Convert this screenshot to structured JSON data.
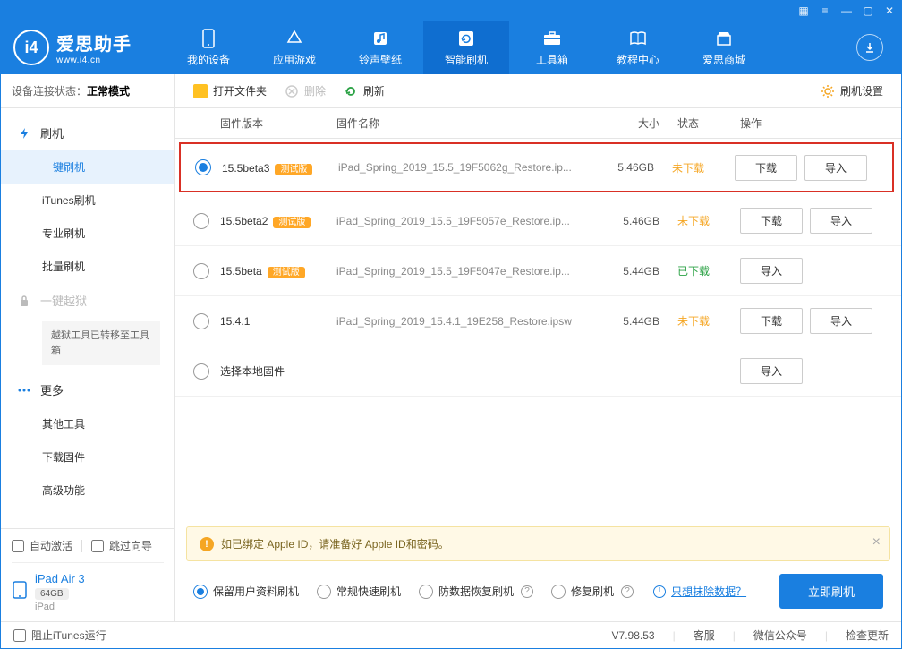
{
  "app": {
    "name": "爱思助手",
    "url": "www.i4.cn"
  },
  "nav": {
    "items": [
      {
        "label": "我的设备"
      },
      {
        "label": "应用游戏"
      },
      {
        "label": "铃声壁纸"
      },
      {
        "label": "智能刷机"
      },
      {
        "label": "工具箱"
      },
      {
        "label": "教程中心"
      },
      {
        "label": "爱思商城"
      }
    ]
  },
  "sidebar": {
    "status_label": "设备连接状态：",
    "status_value": "正常模式",
    "flash_root": "刷机",
    "items": [
      {
        "label": "一键刷机"
      },
      {
        "label": "iTunes刷机"
      },
      {
        "label": "专业刷机"
      },
      {
        "label": "批量刷机"
      }
    ],
    "jailbreak": "一键越狱",
    "jailbreak_msg": "越狱工具已转移至工具箱",
    "more": "更多",
    "more_items": [
      {
        "label": "其他工具"
      },
      {
        "label": "下载固件"
      },
      {
        "label": "高级功能"
      }
    ],
    "auto_activate": "自动激活",
    "skip_guide": "跳过向导",
    "device_name": "iPad Air 3",
    "device_storage": "64GB",
    "device_type": "iPad"
  },
  "toolbar": {
    "open": "打开文件夹",
    "delete": "删除",
    "refresh": "刷新",
    "settings": "刷机设置"
  },
  "table": {
    "headers": {
      "version": "固件版本",
      "name": "固件名称",
      "size": "大小",
      "status": "状态",
      "ops": "操作"
    },
    "beta_badge": "测试版",
    "btn_download": "下载",
    "btn_import": "导入",
    "rows": [
      {
        "version": "15.5beta3",
        "beta": true,
        "name": "iPad_Spring_2019_15.5_19F5062g_Restore.ip...",
        "size": "5.46GB",
        "status": "未下载",
        "status_cls": "orange",
        "show_dl": true,
        "selected": true
      },
      {
        "version": "15.5beta2",
        "beta": true,
        "name": "iPad_Spring_2019_15.5_19F5057e_Restore.ip...",
        "size": "5.46GB",
        "status": "未下载",
        "status_cls": "orange",
        "show_dl": true,
        "selected": false
      },
      {
        "version": "15.5beta",
        "beta": true,
        "name": "iPad_Spring_2019_15.5_19F5047e_Restore.ip...",
        "size": "5.44GB",
        "status": "已下载",
        "status_cls": "green",
        "show_dl": false,
        "selected": false
      },
      {
        "version": "15.4.1",
        "beta": false,
        "name": "iPad_Spring_2019_15.4.1_19E258_Restore.ipsw",
        "size": "5.44GB",
        "status": "未下载",
        "status_cls": "orange",
        "show_dl": true,
        "selected": false
      }
    ],
    "local_row": "选择本地固件"
  },
  "warn": {
    "text": "如已绑定 Apple ID，请准备好 Apple ID和密码。"
  },
  "actions": {
    "opt1": "保留用户资料刷机",
    "opt2": "常规快速刷机",
    "opt3": "防数据恢复刷机",
    "opt4": "修复刷机",
    "erase_link": "只想抹除数据？",
    "primary": "立即刷机"
  },
  "statusbar": {
    "block_itunes": "阻止iTunes运行",
    "version": "V7.98.53",
    "support": "客服",
    "wechat": "微信公众号",
    "update": "检查更新"
  }
}
